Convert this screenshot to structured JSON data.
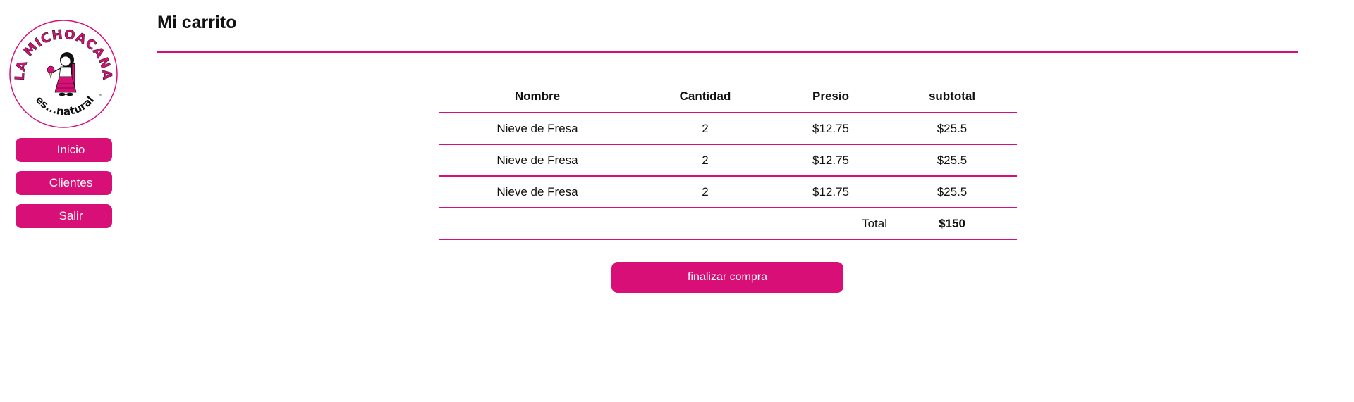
{
  "sidebar": {
    "logo": {
      "brand_text": "LA MICHOACANA",
      "tagline": "es...natural",
      "trademark": "®"
    },
    "nav": [
      {
        "label": "Inicio"
      },
      {
        "label": "Clientes"
      },
      {
        "label": "Salir"
      }
    ]
  },
  "header": {
    "title": "Mi carrito"
  },
  "cart": {
    "columns": [
      "Nombre",
      "Cantidad",
      "Presio",
      "subtotal"
    ],
    "rows": [
      {
        "nombre": "Nieve de Fresa",
        "cantidad": "2",
        "precio": "$12.75",
        "subtotal": "$25.5"
      },
      {
        "nombre": "Nieve de Fresa",
        "cantidad": "2",
        "precio": "$12.75",
        "subtotal": "$25.5"
      },
      {
        "nombre": "Nieve de Fresa",
        "cantidad": "2",
        "precio": "$12.75",
        "subtotal": "$25.5"
      }
    ],
    "total_label": "Total",
    "total_value": "$150"
  },
  "checkout": {
    "label": "finalizar compra"
  },
  "colors": {
    "accent": "#d70f76",
    "text": "#111111",
    "background": "#ffffff"
  }
}
